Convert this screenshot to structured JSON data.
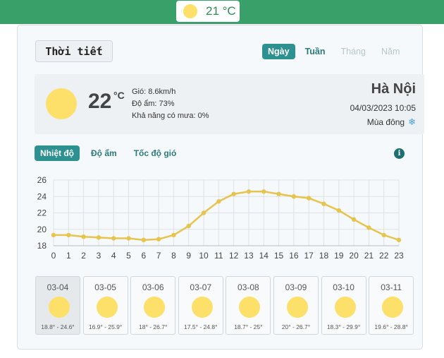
{
  "header": {
    "temp": "21 °C",
    "icon": "sun-icon"
  },
  "title": "Thời tiết",
  "period_tabs": [
    {
      "label": "Ngày",
      "state": "active"
    },
    {
      "label": "Tuần",
      "state": "normal"
    },
    {
      "label": "Tháng",
      "state": "disabled"
    },
    {
      "label": "Năm",
      "state": "disabled"
    }
  ],
  "current": {
    "temp": "22",
    "unit": "°C",
    "wind": "Gió: 8.6km/h",
    "humidity": "Độ ẩm: 73%",
    "rain": "Khả năng có mưa: 0%",
    "city": "Hà Nội",
    "datetime": "04/03/2023 10:05",
    "season": "Mùa đông",
    "season_icon": "snowflake-icon"
  },
  "metric_tabs": [
    {
      "label": "Nhiệt độ",
      "active": true
    },
    {
      "label": "Độ ẩm",
      "active": false
    },
    {
      "label": "Tốc độ gió",
      "active": false
    }
  ],
  "chart_data": {
    "type": "line",
    "x": [
      0,
      1,
      2,
      3,
      4,
      5,
      6,
      7,
      8,
      9,
      10,
      11,
      12,
      13,
      14,
      15,
      16,
      17,
      18,
      19,
      20,
      21,
      22,
      23
    ],
    "series": [
      {
        "values": [
          19.3,
          19.3,
          19.1,
          19.0,
          18.9,
          18.9,
          18.7,
          18.8,
          19.3,
          20.4,
          22.0,
          23.4,
          24.3,
          24.6,
          24.6,
          24.3,
          24.0,
          23.8,
          23.1,
          22.3,
          21.2,
          20.2,
          19.3,
          18.7
        ],
        "color": "#e6c44e"
      }
    ],
    "ylim": [
      18,
      26
    ],
    "yticks": [
      18,
      20,
      22,
      24,
      26
    ],
    "grid": true
  },
  "forecast": [
    {
      "date": "03-04",
      "range": "18.8° - 24.6°",
      "selected": true
    },
    {
      "date": "03-05",
      "range": "16.9° - 25.9°",
      "selected": false
    },
    {
      "date": "03-06",
      "range": "18° - 26.7°",
      "selected": false
    },
    {
      "date": "03-07",
      "range": "17.5° - 24.8°",
      "selected": false
    },
    {
      "date": "03-08",
      "range": "18.7° - 25°",
      "selected": false
    },
    {
      "date": "03-09",
      "range": "20° - 26.7°",
      "selected": false
    },
    {
      "date": "03-10",
      "range": "18.3° - 29.9°",
      "selected": false
    },
    {
      "date": "03-11",
      "range": "19.6° - 28.8°",
      "selected": false
    }
  ]
}
